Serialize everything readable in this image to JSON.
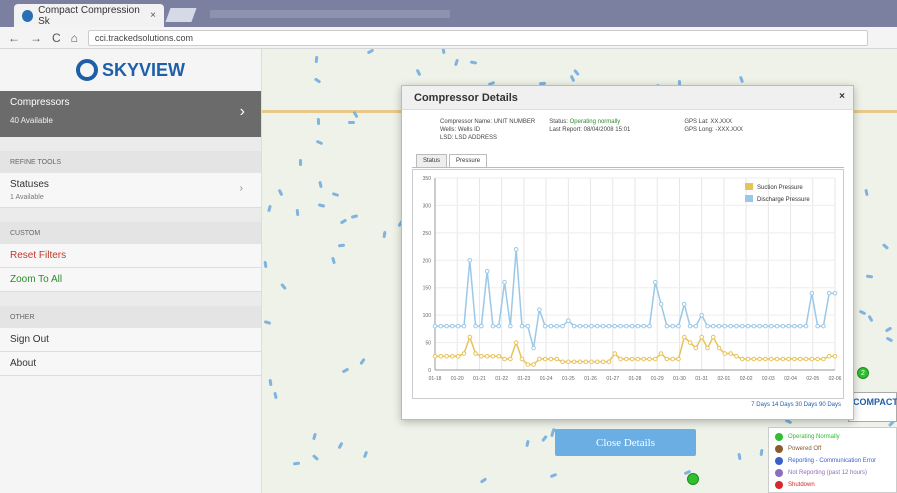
{
  "browser": {
    "tab_title": "Compact Compression Sk",
    "tab_close": "×",
    "url": "cci.trackedsolutions.com",
    "back": "←",
    "forward": "→",
    "reload": "C",
    "home": "⌂"
  },
  "sidebar": {
    "logo_text": "SKYVIEW",
    "compressors": {
      "label": "Compressors",
      "count": "40 Available"
    },
    "refine_header": "REFINE TOOLS",
    "statuses": {
      "label": "Statuses",
      "sub": "1 Available"
    },
    "custom_header": "CUSTOM",
    "reset_filters": "Reset Filters",
    "zoom_to_all": "Zoom To All",
    "other_header": "OTHER",
    "sign_out": "Sign Out",
    "about": "About"
  },
  "modal": {
    "title": "Compressor Details",
    "close": "×",
    "info": {
      "name_line": "Compressor Name: UNIT NUMBER",
      "wells_line": "Wells: Wells ID",
      "lsd_line": "LSD: LSD ADDRESS",
      "status_label": "Status:",
      "status_value": "Operating normally",
      "last_report": "Last Report: 08/04/2008 15:01",
      "gps_lat": "GPS Lat: XX.XXX",
      "gps_long": "GPS Long: -XXX.XXX"
    },
    "tabs": [
      "Status",
      "Pressure"
    ],
    "range_links": "7 Days 14 Days 30 Days 90 Days"
  },
  "chart_data": {
    "type": "line",
    "series": [
      {
        "name": "Suction Pressure",
        "color": "#e8c25a",
        "values": [
          25,
          25,
          25,
          25,
          25,
          30,
          60,
          30,
          25,
          25,
          25,
          25,
          20,
          20,
          50,
          20,
          10,
          10,
          20,
          20,
          20,
          20,
          15,
          15,
          15,
          15,
          15,
          15,
          15,
          15,
          15,
          30,
          20,
          20,
          20,
          20,
          20,
          20,
          20,
          30,
          20,
          20,
          20,
          60,
          50,
          40,
          60,
          40,
          60,
          40,
          30,
          30,
          25,
          20,
          20,
          20,
          20,
          20,
          20,
          20,
          20,
          20,
          20,
          20,
          20,
          20,
          20,
          20,
          25,
          25
        ]
      },
      {
        "name": "Discharge Pressure",
        "color": "#9cc8e8",
        "values": [
          80,
          80,
          80,
          80,
          80,
          80,
          200,
          80,
          80,
          180,
          80,
          80,
          160,
          80,
          220,
          80,
          80,
          40,
          110,
          80,
          80,
          80,
          80,
          90,
          80,
          80,
          80,
          80,
          80,
          80,
          80,
          80,
          80,
          80,
          80,
          80,
          80,
          80,
          160,
          120,
          80,
          80,
          80,
          120,
          80,
          80,
          100,
          80,
          80,
          80,
          80,
          80,
          80,
          80,
          80,
          80,
          80,
          80,
          80,
          80,
          80,
          80,
          80,
          80,
          80,
          140,
          80,
          80,
          140,
          140
        ]
      }
    ],
    "x_ticks": [
      "01-18",
      "01-20",
      "01-21",
      "01-22",
      "01-23",
      "01-24",
      "01-25",
      "01-26",
      "01-27",
      "01-28",
      "01-29",
      "01-30",
      "01-31",
      "02-01",
      "02-02",
      "02-03",
      "02-04",
      "02-05",
      "02-06"
    ],
    "ylim": [
      0,
      350
    ],
    "legend_position": "top-right",
    "grid": true
  },
  "legend": {
    "items": [
      {
        "label": "Operating Normally",
        "color": "#2fbf2f"
      },
      {
        "label": "Powered Off",
        "color": "#8b5a2b"
      },
      {
        "label": "Reporting - Communication Error",
        "color": "#3a5fcd"
      },
      {
        "label": "Not Reporting (past 12 hours)",
        "color": "#8a6fbf"
      },
      {
        "label": "Shutdown",
        "color": "#d62828"
      }
    ]
  },
  "close_button": "Close Details",
  "compact_logo": "COMPACT",
  "map_marker_label": "2"
}
